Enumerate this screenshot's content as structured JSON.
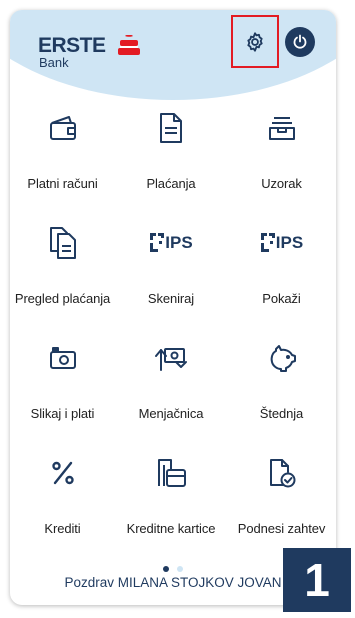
{
  "header": {
    "logo_name": "ERSTE",
    "logo_sub": "Bank",
    "settings_icon": "gear-icon",
    "power_icon": "power-icon",
    "accent_color": "#e31b23",
    "brand_color": "#1f3a5f"
  },
  "tiles": [
    {
      "label": "Platni računi",
      "icon": "wallet-icon"
    },
    {
      "label": "Plaćanja",
      "icon": "document-icon"
    },
    {
      "label": "Uzorak",
      "icon": "tray-icon"
    },
    {
      "label": "Pregled plaćanja",
      "icon": "documents-stack-icon"
    },
    {
      "label": "Skeniraj",
      "icon": "ips-scan-icon",
      "badge": "IPS"
    },
    {
      "label": "Pokaži",
      "icon": "ips-show-icon",
      "badge": "IPS"
    },
    {
      "label": "Slikaj i plati",
      "icon": "camera-icon"
    },
    {
      "label": "Menjačnica",
      "icon": "exchange-icon"
    },
    {
      "label": "Štednja",
      "icon": "piggy-bank-icon"
    },
    {
      "label": "Krediti",
      "icon": "percent-icon"
    },
    {
      "label": "Kreditne kartice",
      "icon": "credit-card-icon"
    },
    {
      "label": "Podnesi zahtev",
      "icon": "document-check-icon"
    }
  ],
  "pagination": {
    "pages": 2,
    "current": 1
  },
  "greeting": "Pozdrav MILANA STOJKOV JOVAN",
  "step_badge": "1"
}
